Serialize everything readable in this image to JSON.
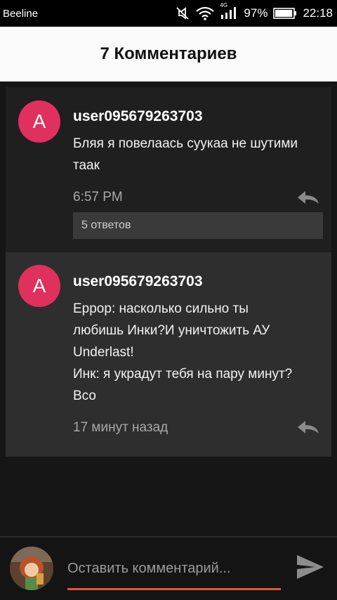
{
  "status_bar": {
    "carrier": "Beeline",
    "network_type": "4G",
    "battery_percent": "97%",
    "battery_level": 0.97,
    "time": "22:18",
    "icons": [
      "mute-icon",
      "wifi-icon",
      "signal-icon",
      "battery-icon"
    ]
  },
  "header": {
    "title": "7 Комментариев"
  },
  "comments": [
    {
      "avatar_letter": "A",
      "avatar_color": "#e0305e",
      "username": "user095679263703",
      "text": "Бляя я повелаась суукаа не шутими таак",
      "time": "6:57 PM",
      "replies_label": "5 ответов"
    },
    {
      "avatar_letter": "A",
      "avatar_color": "#e0305e",
      "username": "user095679263703",
      "text_lines": [
        "Еррор: насколько сильно ты",
        "любишь Инки?И уничтожить АУ",
        "Underlast!",
        "Инк: я украдут тебя на пару минут?",
        "Всо"
      ],
      "time": "17 минут назад"
    }
  ],
  "composer": {
    "placeholder": "Оставить комментарий...",
    "accent_color": "#e8562c"
  }
}
